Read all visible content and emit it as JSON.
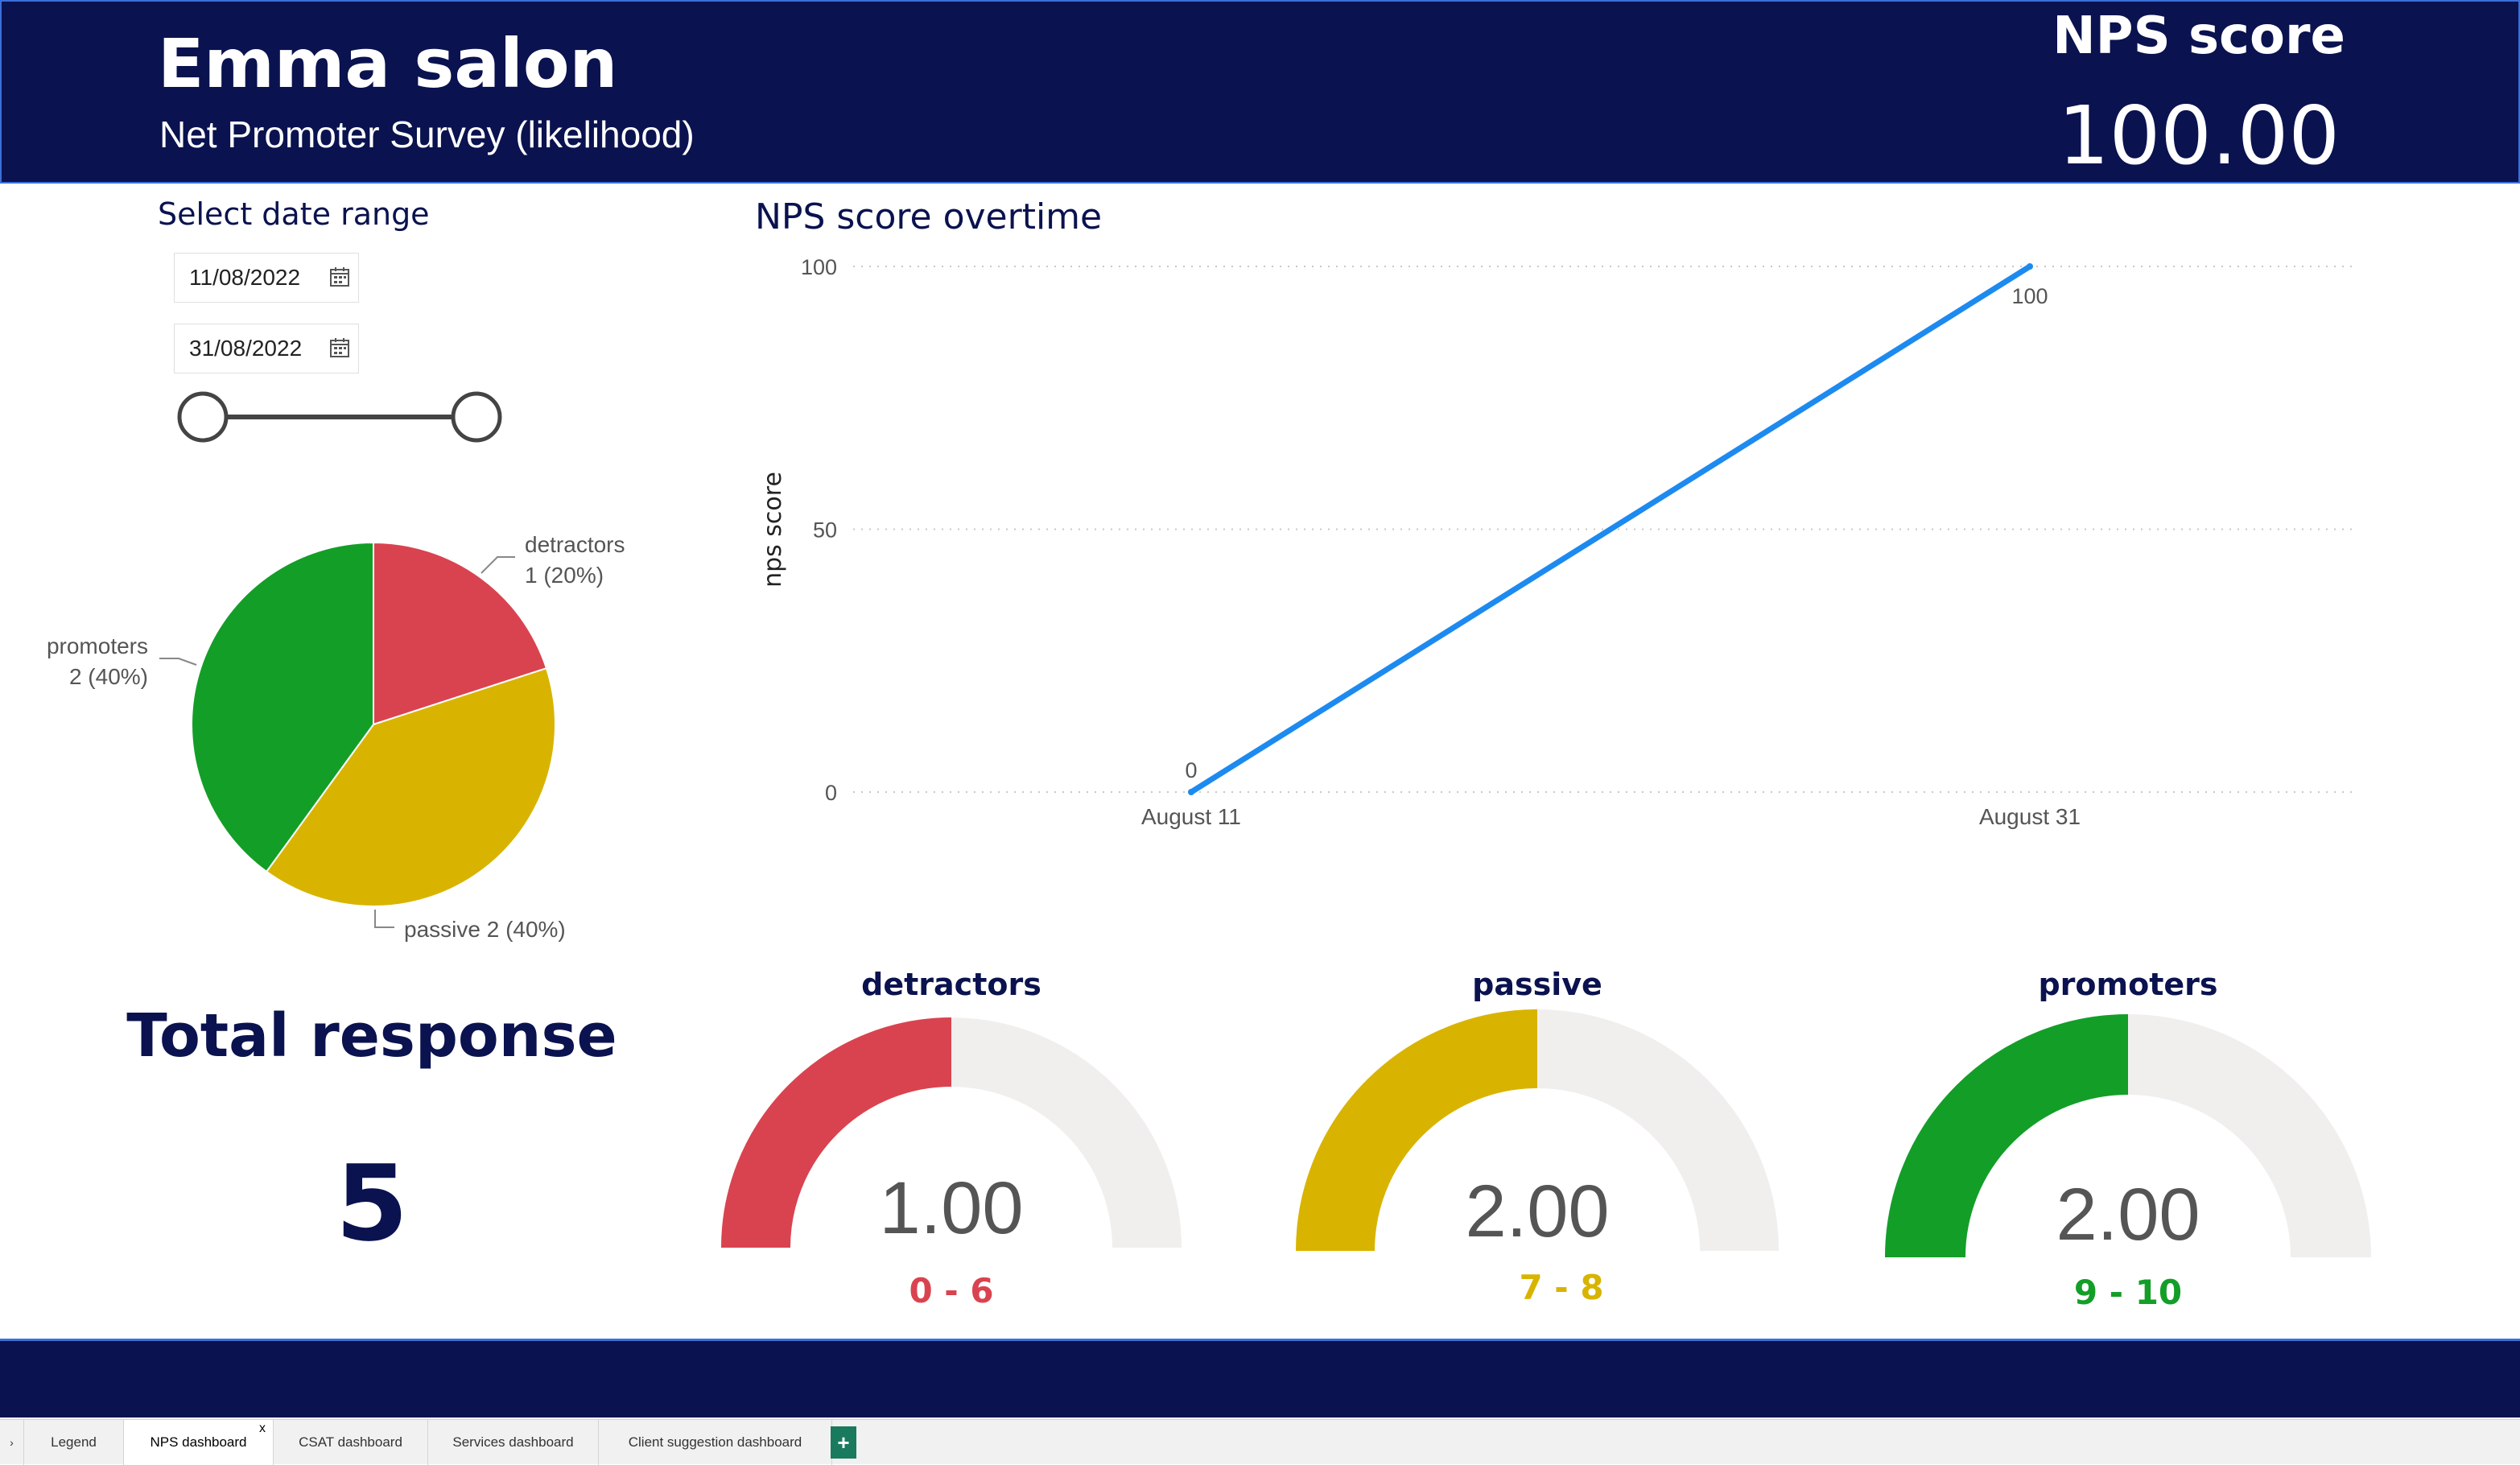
{
  "header": {
    "title": "Emma salon",
    "subtitle": "Net Promoter Survey (likelihood)",
    "nps_label": "NPS score",
    "nps_value": "100.00"
  },
  "date_range": {
    "label": "Select date range",
    "start": "11/08/2022",
    "end": "31/08/2022"
  },
  "pie": {
    "detractors_name": "detractors",
    "detractors_value": "1 (20%)",
    "promoters_name": "promoters",
    "promoters_value": "2 (40%)",
    "passive_label": "passive 2 (40%)"
  },
  "total": {
    "label": "Total response",
    "value": "5"
  },
  "gauges": [
    {
      "title": "detractors",
      "value": "1.00",
      "range": "0 - 6",
      "color": "#d9434f",
      "fraction": 0.5
    },
    {
      "title": "passive",
      "value": "2.00",
      "range": "7 - 8",
      "color": "#d8b400",
      "fraction": 0.5
    },
    {
      "title": "promoters",
      "value": "2.00",
      "range": "9 - 10",
      "color": "#139e28",
      "fraction": 0.5
    }
  ],
  "colors": {
    "navy": "#0a124f",
    "detractors": "#d9434f",
    "passive": "#d8b400",
    "promoters": "#139e28",
    "line": "#1d8af0",
    "gauge_track": "#f0efee"
  },
  "tabs": [
    "Legend",
    "NPS dashboard",
    "CSAT dashboard",
    "Services dashboard",
    "Client suggestion dashboard"
  ],
  "tab_add": "+",
  "tab_close": "x",
  "chart_data": [
    {
      "type": "line",
      "title": "NPS score overtime",
      "ylabel": "nps score",
      "xlabel": "",
      "x": [
        "August 11",
        "August 31"
      ],
      "series": [
        {
          "values": [
            0,
            100
          ]
        }
      ],
      "data_labels": [
        "0",
        "100"
      ],
      "yticks": [
        0,
        50,
        100
      ],
      "ylim": [
        0,
        100
      ],
      "grid": true
    },
    {
      "type": "pie",
      "categories": [
        "detractors",
        "passive",
        "promoters"
      ],
      "values": [
        1,
        2,
        2
      ],
      "percent": [
        20,
        40,
        40
      ]
    }
  ]
}
